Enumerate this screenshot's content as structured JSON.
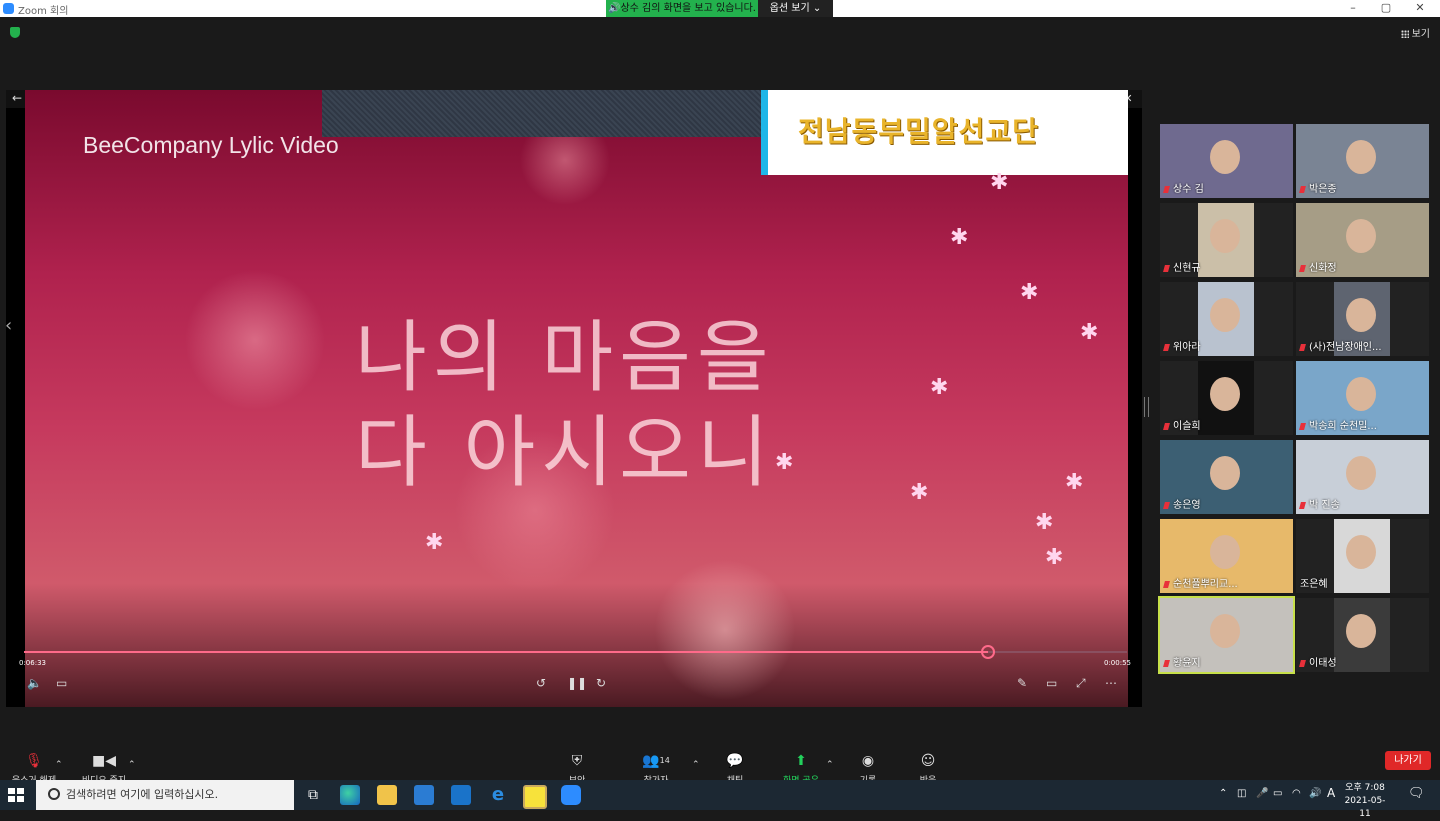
{
  "window": {
    "title": "Zoom 회의"
  },
  "share_banner": {
    "text": "🔊상수 김의 화면을 보고 있습니다.",
    "view_options": "옵션 보기 ⌄"
  },
  "top_right": {
    "gallery_label": "보기"
  },
  "video": {
    "brand": "BeeCompany Lylic Video",
    "banner": "전남동부밀알선교단",
    "lyric_line1": "나의 마음을",
    "lyric_line2": "다 아시오니",
    "time_elapsed": "0:06:33",
    "time_remaining": "0:00:55",
    "progress_fraction": 0.874
  },
  "participants": [
    {
      "name": "상수 김",
      "bg": "#6f6a8f"
    },
    {
      "name": "박은종",
      "bg": "#7a8494"
    },
    {
      "name": "신현규",
      "bg": "#cbbfa8"
    },
    {
      "name": "신화정",
      "bg": "#a69d86"
    },
    {
      "name": "위아라",
      "bg": "#b9c2cf"
    },
    {
      "name": "(사)전남장애인...",
      "bg": "#5e6470"
    },
    {
      "name": "이슬희",
      "bg": "#111111"
    },
    {
      "name": "박송희 순천밀...",
      "bg": "#7aa6c9"
    },
    {
      "name": "송은영",
      "bg": "#3c5f73"
    },
    {
      "name": "박 진송",
      "bg": "#c8cfd8"
    },
    {
      "name": "순천풀뿌리교...",
      "bg": "#e7b96a"
    },
    {
      "name": "조은혜",
      "bg": "#d8d8d8"
    },
    {
      "name": "황윤지",
      "bg": "#c4c1bc"
    },
    {
      "name": "이태성",
      "bg": "#3b3b3b"
    }
  ],
  "toolbar": {
    "unmute": "음소거 해제",
    "stop_video": "비디오 중지",
    "security": "보안",
    "participants": "참가자",
    "participants_count": "14",
    "chat": "채팅",
    "share_screen": "화면 공유",
    "record": "기록",
    "reactions": "반응",
    "leave": "나가기"
  },
  "taskbar": {
    "search_placeholder": "검색하려면 여기에 입력하십시오.",
    "ime": "A",
    "time": "오후 7:08",
    "date": "2021-05-11"
  }
}
